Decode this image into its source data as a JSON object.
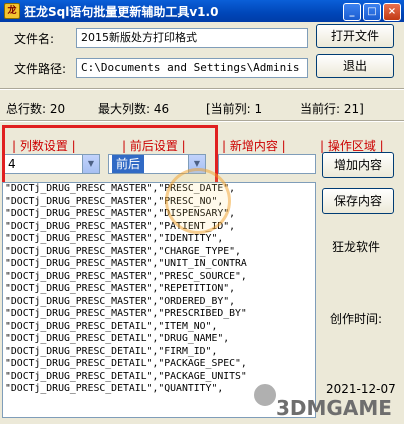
{
  "window": {
    "title": "狂龙Sql语句批量更新辅助工具v1.0",
    "icon": "app-icon",
    "controls": [
      "_",
      "□",
      "×"
    ]
  },
  "file": {
    "name_label": "文件名:",
    "name_value": "2015新版处方打印格式",
    "path_label": "文件路径:",
    "path_value": "C:\\Documents and Settings\\Adminis",
    "open_button": "打开文件",
    "exit_button": "退出"
  },
  "stats": {
    "total_rows": "总行数: 20",
    "max_cols": "最大列数: 46",
    "current_col": "[当前列: 1",
    "current_row": "当前行: 21]"
  },
  "sections": {
    "col_settings": "| 列数设置 |",
    "prefix_settings": "| 前后设置 |",
    "new_content": "| 新增内容 |",
    "operation_area": "| 操作区域 |"
  },
  "col_combo": {
    "value": "4"
  },
  "prefix_combo": {
    "value": "前后"
  },
  "new_content_input": {
    "value": ""
  },
  "buttons": {
    "add_content": "增加内容",
    "save_content": "保存内容"
  },
  "side": {
    "brand": "狂龙软件",
    "created_label": "创作时间:",
    "date": "2021-12-07"
  },
  "list_items": [
    "\"DOCTj_DRUG_PRESC_MASTER\",\"PRESC_DATE\",",
    "\"DOCTj_DRUG_PRESC_MASTER\",\"PRESC_NO\",",
    "\"DOCTj_DRUG_PRESC_MASTER\",\"DISPENSARY\",",
    "\"DOCTj_DRUG_PRESC_MASTER\",\"PATIENT_ID\",",
    "\"DOCTj_DRUG_PRESC_MASTER\",\"IDENTITY\",",
    "\"DOCTj_DRUG_PRESC_MASTER\",\"CHARGE_TYPE\",",
    "\"DOCTj_DRUG_PRESC_MASTER\",\"UNIT_IN_CONTRA",
    "\"DOCTj_DRUG_PRESC_MASTER\",\"PRESC_SOURCE\",",
    "\"DOCTj_DRUG_PRESC_MASTER\",\"REPETITION\",",
    "\"DOCTj_DRUG_PRESC_MASTER\",\"ORDERED_BY\",",
    "\"DOCTj_DRUG_PRESC_MASTER\",\"PRESCRIBED_BY\"",
    "\"DOCTj_DRUG_PRESC_DETAIL\",\"ITEM_NO\",",
    "\"DOCTj_DRUG_PRESC_DETAIL\",\"DRUG_NAME\",",
    "\"DOCTj_DRUG_PRESC_DETAIL\",\"FIRM_ID\",",
    "\"DOCTj_DRUG_PRESC_DETAIL\",\"PACKAGE_SPEC\",",
    "\"DOCTj_DRUG_PRESC_DETAIL\",\"PACKAGE_UNITS\"",
    "\"DOCTj_DRUG_PRESC_DETAIL\",\"QUANTITY\","
  ],
  "watermark": {
    "text": "3DMGAME"
  }
}
